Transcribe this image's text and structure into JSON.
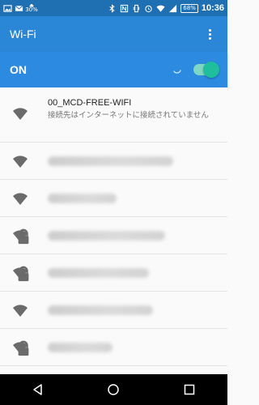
{
  "status_bar": {
    "left_icons": [
      "image-icon",
      "mail-icon",
      "cloud-icon"
    ],
    "temperature": "30%",
    "right_icons": [
      "bluetooth-icon",
      "nfc-icon",
      "vibrate-icon",
      "alarm-icon",
      "wifi-icon",
      "signal-icon"
    ],
    "battery": "68%",
    "time": "10:36"
  },
  "app_bar": {
    "title": "Wi-Fi"
  },
  "toggle": {
    "label": "ON",
    "state": "on"
  },
  "networks": [
    {
      "name": "00_MCD-FREE-WIFI",
      "status": "接続先はインターネットに接続されていません",
      "secured": false
    },
    {
      "blurred": true,
      "secured": false,
      "blur_width": 155
    },
    {
      "blurred": true,
      "secured": false,
      "blur_width": 85
    },
    {
      "blurred": true,
      "secured": true,
      "blur_width": 145
    },
    {
      "blurred": true,
      "secured": true,
      "blur_width": 125
    },
    {
      "blurred": true,
      "secured": false,
      "blur_width": 130
    },
    {
      "blurred": true,
      "secured": true,
      "blur_width": 80
    },
    {
      "blurred": true,
      "secured": true,
      "blur_width": 90
    }
  ],
  "colors": {
    "status_bar": "#1f6fb3",
    "app_bar": "#2a86d6",
    "toggle_bar": "#2c8ae0",
    "switch_on": "#1fbf9e"
  }
}
